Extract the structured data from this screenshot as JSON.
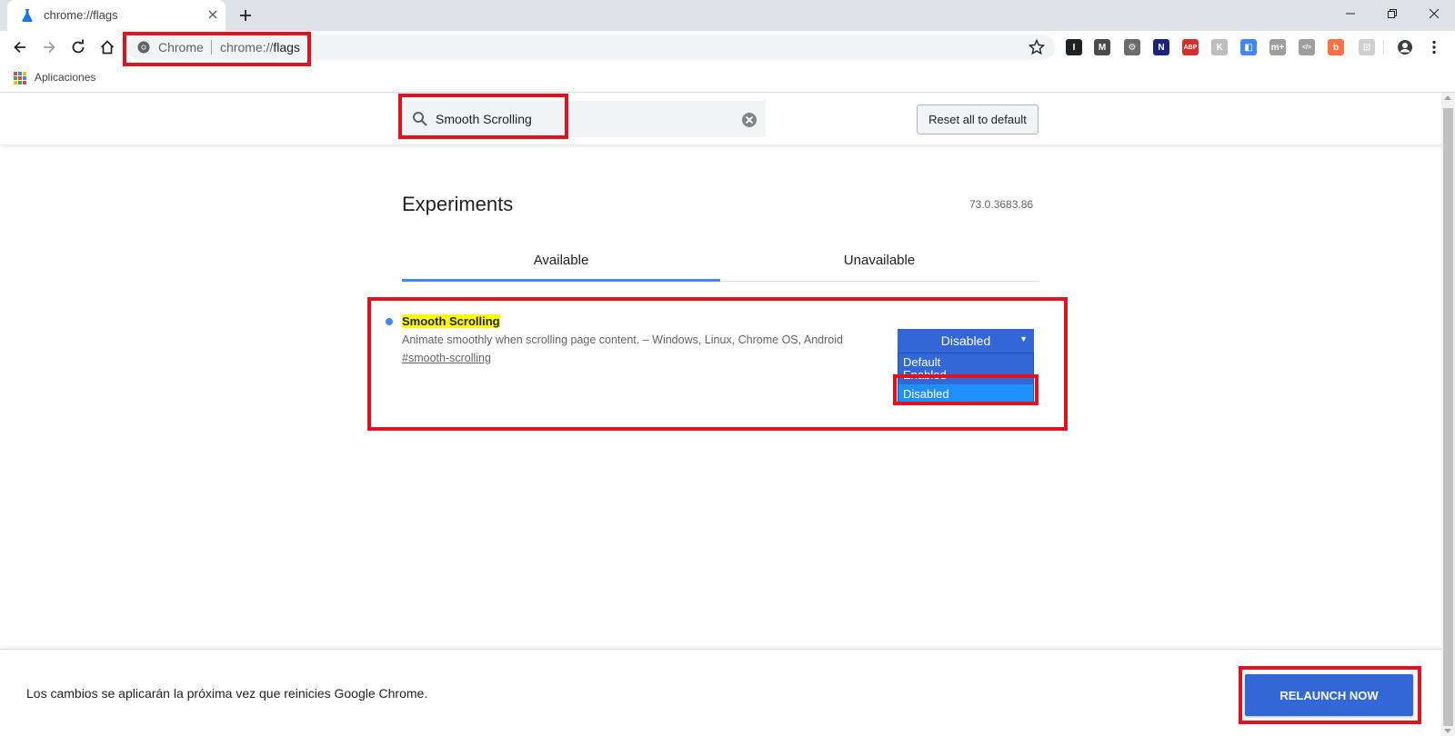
{
  "browser": {
    "tab_title": "chrome://flags",
    "omnibox_chip": "Chrome",
    "url_prefix": "chrome://",
    "url_page": "flags",
    "bookmark_apps": "Aplicaciones"
  },
  "extensions": [
    {
      "name": "ext-i",
      "glyph": "I",
      "color": "#202124"
    },
    {
      "name": "ext-m",
      "glyph": "M",
      "color": "#4a4a4a"
    },
    {
      "name": "ext-gear",
      "glyph": "⚙",
      "color": "#6b6b6b"
    },
    {
      "name": "ext-n",
      "glyph": "N",
      "color": "#1a237e"
    },
    {
      "name": "ext-abp",
      "glyph": "ABP",
      "color": "#d32f2f"
    },
    {
      "name": "ext-k",
      "glyph": "K",
      "color": "#bdbdbd"
    },
    {
      "name": "ext-blue",
      "glyph": "◧",
      "color": "#4285f4"
    },
    {
      "name": "ext-m2",
      "glyph": "m+",
      "color": "#9e9e9e"
    },
    {
      "name": "ext-code",
      "glyph": "</>",
      "color": "#9e9e9e"
    },
    {
      "name": "ext-orange",
      "glyph": "b",
      "color": "#ff7043"
    },
    {
      "name": "ext-lock",
      "glyph": "⊡",
      "color": "#cfcfcf"
    }
  ],
  "header": {
    "search_value": "Smooth Scrolling",
    "reset_label": "Reset all to default"
  },
  "main": {
    "title": "Experiments",
    "version": "73.0.3683.86",
    "tabs": [
      {
        "label": "Available",
        "active": true
      },
      {
        "label": "Unavailable",
        "active": false
      }
    ],
    "flag": {
      "name": "Smooth Scrolling",
      "description": "Animate smoothly when scrolling page content. – Windows, Linux, Chrome OS, Android",
      "anchor": "#smooth-scrolling",
      "selected": "Disabled",
      "options": [
        "Default",
        "Enabled",
        "Disabled"
      ]
    }
  },
  "footer": {
    "message": "Los cambios se aplicarán la próxima vez que reinicies Google Chrome.",
    "relaunch_label": "RELAUNCH NOW"
  },
  "colors": {
    "accent": "#3367d6",
    "highlight": "#ffff00",
    "annotation": "#e0121f"
  }
}
